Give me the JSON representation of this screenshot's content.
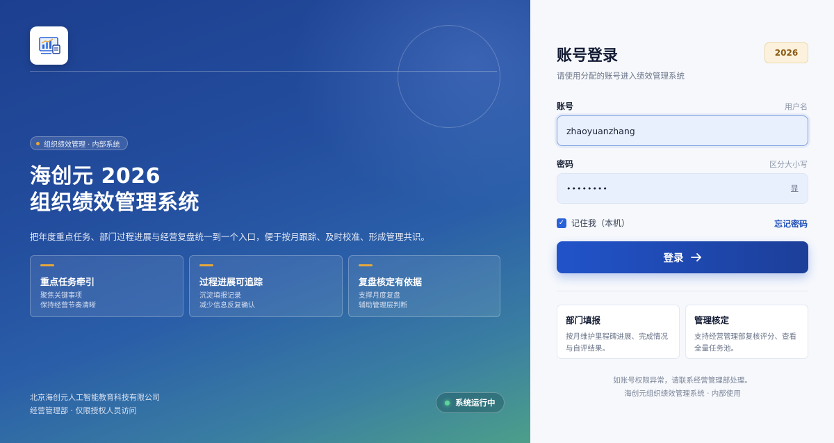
{
  "hero": {
    "tag": "组织绩效管理 · 内部系统",
    "title_line1": "海创元 2026",
    "title_line2": "组织绩效管理系统",
    "description": "把年度重点任务、部门过程进展与经营复盘统一到一个入口，便于按月跟踪、及时校准、形成管理共识。",
    "cards": [
      {
        "title": "重点任务牵引",
        "line1": "聚焦关键事项",
        "line2": "保持经营节奏清晰"
      },
      {
        "title": "过程进展可追踪",
        "line1": "沉淀填报记录",
        "line2": "减少信息反复确认"
      },
      {
        "title": "复盘核定有依据",
        "line1": "支撑月度复盘",
        "line2": "辅助管理层判断"
      }
    ],
    "footer_company": "北京海创元人工智能教育科技有限公司",
    "footer_note": "经营管理部 · 仅限授权人员访问",
    "status": "系统运行中"
  },
  "login": {
    "title": "账号登录",
    "year_badge": "2026",
    "subtitle": "请使用分配的账号进入绩效管理系统",
    "account_label": "账号",
    "account_hint": "用户名",
    "account_value": "zhaoyuanzhang",
    "password_label": "密码",
    "password_hint": "区分大小写",
    "password_value": "••••••••",
    "show_label": "显",
    "remember_label": "记住我（本机）",
    "forgot_label": "忘记密码",
    "submit_label": "登录",
    "cards": [
      {
        "title": "部门填报",
        "text": "按月维护里程碑进展、完成情况与自评结果。"
      },
      {
        "title": "管理核定",
        "text": "支持经营管理部复核评分、查看全量任务池。"
      }
    ],
    "footer_line1": "如账号权限异常，请联系经营管理部处理。",
    "footer_line2": "海创元组织绩效管理系统 · 内部使用"
  },
  "colors": {
    "accent": "#2153c9",
    "gold": "#e6a83b",
    "status_green": "#5ed59b"
  },
  "icons": {
    "logo": "dashboard-chart-icon",
    "arrow": "arrow-right-icon",
    "check": "checkmark-icon"
  }
}
